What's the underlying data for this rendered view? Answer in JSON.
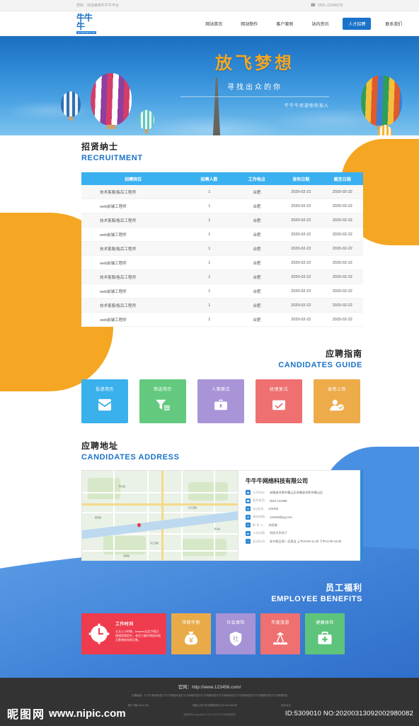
{
  "topbar": {
    "greeting": "您好：欢迎来到牛牛牛平台",
    "phone": "0551-12346578",
    "phone_icon": "phone-icon"
  },
  "header": {
    "logo_text": "牛牛牛",
    "logo_sub": "NIUNIUNIU.CN",
    "nav": [
      {
        "label": "网站首页",
        "active": false
      },
      {
        "label": "网站制作",
        "active": false
      },
      {
        "label": "客户案例",
        "active": false
      },
      {
        "label": "站内资讯",
        "active": false
      },
      {
        "label": "人才招聘",
        "active": true
      },
      {
        "label": "联系我们",
        "active": false
      }
    ]
  },
  "banner": {
    "headline": "放飞梦想",
    "subline": "寻找出众的你",
    "tagline": "牛牛牛欢迎你的加入"
  },
  "recruitment": {
    "title_cn": "招贤纳士",
    "title_en": "RECRUITMENT",
    "columns": [
      "招聘岗位",
      "招聘人数",
      "工作地点",
      "发布日期",
      "截至日期"
    ],
    "rows": [
      [
        "技术客服/售后工程师",
        "1",
        "合肥",
        "2020-02-22",
        "2020-02-22"
      ],
      [
        "web前端工程师",
        "1",
        "合肥",
        "2020-02-22",
        "2020-02-22"
      ],
      [
        "技术客服/售后工程师",
        "1",
        "合肥",
        "2020-02-22",
        "2020-02-22"
      ],
      [
        "web前端工程师",
        "1",
        "合肥",
        "2020-02-22",
        "2020-02-22"
      ],
      [
        "技术客服/售后工程师",
        "1",
        "合肥",
        "2020-02-22",
        "2020-02-22"
      ],
      [
        "web前端工程师",
        "1",
        "合肥",
        "2020-02-22",
        "2020-02-22"
      ],
      [
        "技术客服/售后工程师",
        "1",
        "合肥",
        "2020-02-22",
        "2020-02-22"
      ],
      [
        "web前端工程师",
        "1",
        "合肥",
        "2020-02-22",
        "2020-02-22"
      ],
      [
        "技术客服/售后工程师",
        "1",
        "合肥",
        "2020-02-22",
        "2020-02-22"
      ],
      [
        "web前端工程师",
        "1",
        "合肥",
        "2020-02-22",
        "2020-02-22"
      ]
    ]
  },
  "guide": {
    "title_cn": "应聘指南",
    "title_en": "CANDIDATES GUIDE",
    "cards": [
      {
        "label": "投递简历",
        "color": "#3ab0ec",
        "icon": "envelope-icon"
      },
      {
        "label": "筛选简历",
        "color": "#63c97e",
        "icon": "funnel-icon"
      },
      {
        "label": "人事面试",
        "color": "#a994d8",
        "icon": "briefcase-icon"
      },
      {
        "label": "经理复试",
        "color": "#ef7070",
        "icon": "calendar-check-icon"
      },
      {
        "label": "录用上岗",
        "color": "#edab4a",
        "icon": "user-check-icon"
      }
    ]
  },
  "address": {
    "title_cn": "应聘地址",
    "title_en": "CANDIDATES ADDRESS",
    "company": "牛牛牛网络科技有限公司",
    "map_labels": [
      "合肥市科技馆",
      "黄山路",
      "长江西路",
      "肥西路",
      "望江西路",
      "潜山路",
      "金寨路",
      "天鹅湖",
      "政务区"
    ],
    "rows": [
      {
        "icon": "location-icon",
        "label": "公司地址：",
        "value": "安徽省合肥市蜀山区安徽省合肥市蜀山区"
      },
      {
        "icon": "phone-icon",
        "label": "联系电话：",
        "value": "0551-123465"
      },
      {
        "icon": "qq-icon",
        "label": "QQ咨询：",
        "value": "132456"
      },
      {
        "icon": "mail-icon",
        "label": "服务邮箱：",
        "value": "132456@qq.com"
      },
      {
        "icon": "user-icon",
        "label": "联 系 人：",
        "value": "刘经理"
      },
      {
        "icon": "bus-icon",
        "label": "公交站牌：",
        "value": "科技大学站下"
      },
      {
        "icon": "clock-icon",
        "label": "面试时间：",
        "value": "非节假日周一至周五 上午10:00-11:30 下午14:00-16:30"
      }
    ]
  },
  "benefits": {
    "title_cn": "员工福利",
    "title_en": "EMPLOYEE BENEFITS",
    "cards": [
      {
        "label": "工作时间",
        "color": "#ef3b4e",
        "icon": "clock-icon",
        "wide": true,
        "desc": "五天八小时制，besides法定节假日按国家规定外，老员工额外增加年假天数增加年假天数。"
      },
      {
        "label": "带薪年假",
        "color": "#e8ab48",
        "icon": "money-bag-icon",
        "wide": false
      },
      {
        "label": "社会保险",
        "color": "#a693d6",
        "icon": "shield-icon",
        "wide": false
      },
      {
        "label": "年度旅游",
        "color": "#ef7070",
        "icon": "island-icon",
        "wide": false
      },
      {
        "label": "健康体检",
        "color": "#5ec47c",
        "icon": "medkit-icon",
        "wide": false
      }
    ]
  },
  "footer": {
    "site_label": "官网：",
    "site_url": "http://www.123456.com/",
    "friend_label": "友情链接：",
    "friend_links": "牛牛牛网络科技 牛牛牛网络科技牛牛牛网络科技牛牛牛网络科技牛牛牛网络科技牛牛牛网络科技牛牛牛网络科技牛牛牛网络科技",
    "icp": "皖ICP备14011786",
    "police": "安徽公安厅安全联网单位3401321654号",
    "design": "站内设计",
    "copyright": "版权所有 Copyright© 2019-2020 牛牛牛网络科技"
  },
  "watermark": {
    "cn": "昵图网",
    "url": "www.nipic.com",
    "id": "ID:5309010 NO:20200313092002980082"
  }
}
